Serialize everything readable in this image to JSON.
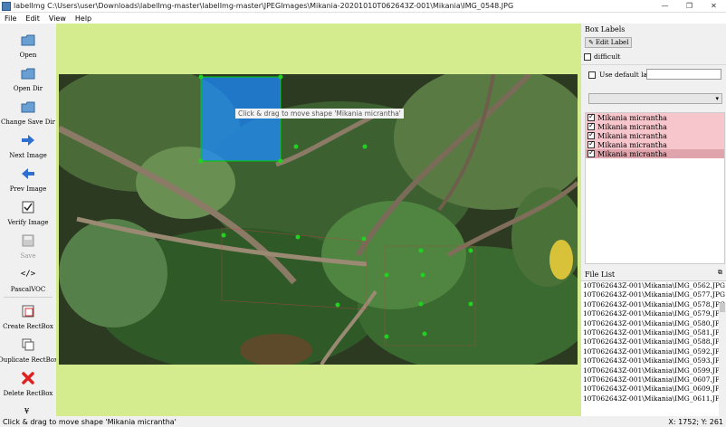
{
  "window": {
    "title": "labelImg C:\\Users\\user\\Downloads\\labelImg-master\\labelImg-master\\JPEGImages\\Mikania-20201010T062643Z-001\\Mikania\\IMG_0548.JPG",
    "min": "—",
    "max": "❐",
    "close": "✕"
  },
  "menu": [
    "File",
    "Edit",
    "View",
    "Help"
  ],
  "toolbar": [
    {
      "label": "Open",
      "icon": "folder-icon"
    },
    {
      "label": "Open Dir",
      "icon": "folder-icon"
    },
    {
      "label": "Change Save Dir",
      "icon": "folder-icon"
    },
    {
      "label": "Next Image",
      "icon": "arrow-right-icon"
    },
    {
      "label": "Prev Image",
      "icon": "arrow-left-icon"
    },
    {
      "label": "Verify Image",
      "icon": "verify-icon"
    },
    {
      "label": "Save",
      "icon": "save-icon"
    },
    {
      "label": "PascalVOC",
      "icon": "format-icon"
    },
    {
      "label": "Create\nRectBox",
      "icon": "create-rect-icon"
    },
    {
      "label": "Duplicate\nRectBox",
      "icon": "duplicate-icon"
    },
    {
      "label": "Delete\nRectBox",
      "icon": "delete-icon"
    }
  ],
  "tooltip": "Click & drag to move shape 'Mikania micrantha'",
  "box_labels": {
    "title": "Box Labels",
    "edit_label": "Edit Label",
    "difficult": "difficult",
    "use_default_label": "Use default label",
    "default_label_value": "",
    "labels": [
      "Mikania micrantha",
      "Mikania micrantha",
      "Mikania micrantha",
      "Mikania micrantha",
      "Mikania micrantha"
    ]
  },
  "file_list": {
    "title": "File List",
    "files": [
      "10T062643Z-001\\Mikania\\IMG_0562.JPG",
      "10T062643Z-001\\Mikania\\IMG_0577.JPG",
      "10T062643Z-001\\Mikania\\IMG_0578.JPG",
      "10T062643Z-001\\Mikania\\IMG_0579.JPG",
      "10T062643Z-001\\Mikania\\IMG_0580.JPG",
      "10T062643Z-001\\Mikania\\IMG_0581.JPG",
      "10T062643Z-001\\Mikania\\IMG_0588.JPG",
      "10T062643Z-001\\Mikania\\IMG_0592.JPG",
      "10T062643Z-001\\Mikania\\IMG_0593.JPG",
      "10T062643Z-001\\Mikania\\IMG_0599.JPG",
      "10T062643Z-001\\Mikania\\IMG_0607.JPG",
      "10T062643Z-001\\Mikania\\IMG_0609.JPG",
      "10T062643Z-001\\Mikania\\IMG_0611.JPG"
    ]
  },
  "status": {
    "message": "Click & drag to move shape 'Mikania micrantha'",
    "coords": "X: 1752; Y: 261"
  },
  "colors": {
    "canvas_bg": "#d4ec8e",
    "label_row_bg": "#f7c6cc",
    "selected_box_fill": "#1e8cff",
    "vertex_green": "#22d022"
  }
}
